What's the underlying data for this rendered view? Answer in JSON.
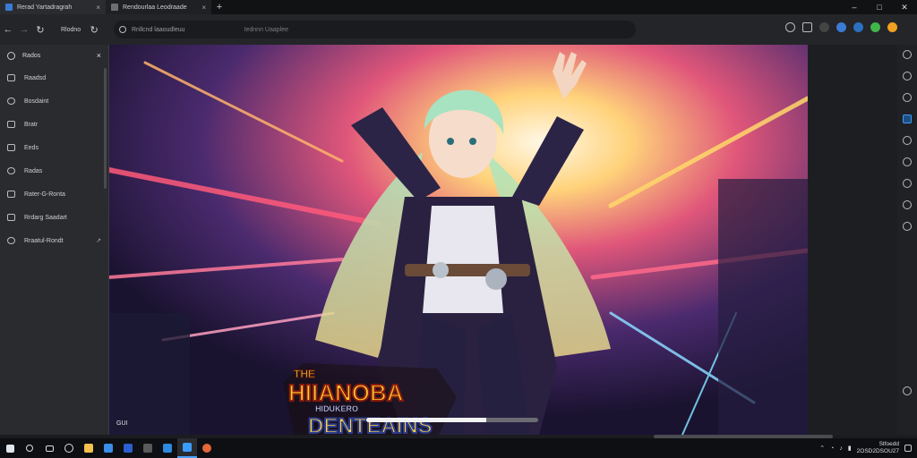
{
  "tabs": [
    {
      "label": "Rerad Yartadragrah",
      "active": true
    },
    {
      "label": "Rendourlaa Leodraade",
      "active": false
    }
  ],
  "toolbar": {
    "home_label": "Rlodno",
    "address_url": "Rnllcnd laaoudleuu",
    "address_placeholder": "Iednnn Uaaplee"
  },
  "side_panel": {
    "items": [
      {
        "label": "Rados",
        "icon": "search-icon"
      },
      {
        "label": "Raadsd",
        "icon": "folder-icon"
      },
      {
        "label": "Bosdaint",
        "icon": "monitor-icon"
      },
      {
        "label": "Bratr",
        "icon": "card-icon"
      },
      {
        "label": "Eeds",
        "icon": "lock-icon"
      },
      {
        "label": "Radas",
        "icon": "history-icon"
      },
      {
        "label": "Rater-G-Ronta",
        "icon": "document-icon"
      },
      {
        "label": "Rrdarg Saadart",
        "icon": "window-icon"
      },
      {
        "label": "Rraatul-Rondt",
        "icon": "settings-icon",
        "tail": "↗"
      }
    ]
  },
  "media": {
    "logo_line1": "THE",
    "logo_line2": "HIIANOBA",
    "logo_line3": "HIDUKERO",
    "logo_line4": "DENTEAINS",
    "corner_label": "GUI",
    "progress": 0.7
  },
  "taskbar": {
    "clock_time": "Stfoedd",
    "clock_date": "2OSD2DSOU27"
  },
  "colors": {
    "accent": "#3b9cff",
    "taskbar_active": "#4aa3ff"
  }
}
